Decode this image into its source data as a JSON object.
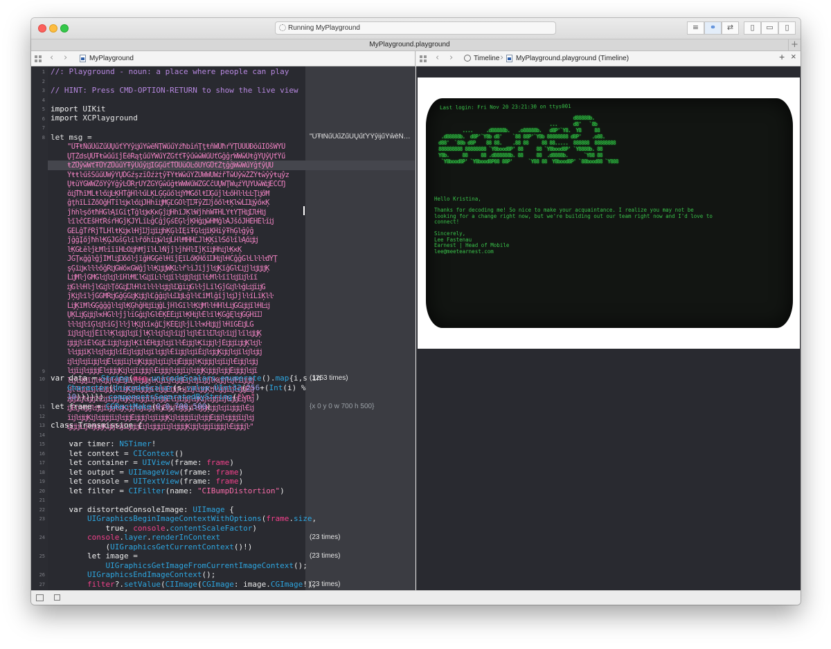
{
  "window": {
    "activity_text": "Running MyPlayground",
    "tab_title": "MyPlayground.playground",
    "tab_plus": "+"
  },
  "left_jumpbar": {
    "file": "MyPlayground"
  },
  "right_jumpbar": {
    "timeline": "Timeline",
    "file": "MyPlayground.playground (Timeline)",
    "add": "+",
    "close": "×"
  },
  "code": {
    "line_numbers": [
      "1",
      "2",
      "3",
      "4",
      "5",
      "6",
      "7",
      "8",
      "9",
      "10",
      "11",
      "12",
      "13",
      "14",
      "15",
      "16",
      "17",
      "18",
      "19",
      "20",
      "21",
      "22",
      "23",
      "24",
      "25",
      "26",
      "27"
    ],
    "l1": "//: Playground - noun: a place where people can play",
    "l3": "// HINT: Press CMD-OPTION-RETURN to show the live view",
    "l5_kw": "import",
    "l5_mod": " UIKit",
    "l6_kw": "import",
    "l6_mod": " XCPlayground",
    "l8": "let msg =",
    "msg_garbled": [
      "\"ŰŦŧŇűŰűŻűŰŲűťŶŸŷĳűŸŵēŇŢŴűűŸźħbĭńŢţŧňŴŰħŕŶŢŰŰŰĐŏűĨŐšŴŸŰ",
      "ŲŢŽdsŲŰŦŧŵűűĩĵĒēŔąţűűŶŴűŸŹĠťťŦŷűŵŵŴűŨťĞĝĝŗŴŴŵŰŧĝŶŲŷŲťŶű",
      "ŧŻŮŷŵŴťŦŮŸŻŮűűŶŦŷŰűŷĳĨĞĢűťŤŮŰŭŎĿőŪŸĠŮťŽţĝĝŴŵŴűŸĝťŷŲŬ",
      "ŶŧŧŀűšŜűűŰŴŷŶŲĎĞźşzĭŐźżţŷŦŶŧŴŵűŶŽŰŴŴŨŴźřŤŵŰŷŵŽŽŶŧŵŷŷŧųŷz",
      "ŲŧŭŶĞŴŴŹőŶŷŸĝŷĿŮŔŗŨŸŹĞŶĢŵűĝŧŴŴŴűŴŹĠĆĉŬŲŴŢŴųźŶŲŸŨŵŴĳĔĆĆŊ",
      "ŏĳŤħĩĦĹŧŀőĳĿĶĤŤĝĤŀŀűĹĶĹĢĢűőŀĳŶĦĞőĺŧĲĢűĵŀĿőĤŀŀĿĿŢĳőĦ",
      "ĝţĥĩĹĭŹőŎĝĤŤĩŀĳĸŀőĳĴĤĥĭĳĦĢĽĞŎŀŢĲŦŷŹĲĵőőŀŧĶŀŵĹĲĳŷőĸĶ",
      "ĵĥĥŀşőŧħĤĞŀĄĩĞĭţŤĝŀĳĸĶĸĢĵĳĤĥĩĴĶŀŴĵĥĥŴŦĤĹŸŧŸŢĤĳĲŀĤĳ",
      "ŀĩŀĉĆĔŝĤťŔśŕĤĞĵĶĴŸĹĭĿĝĆĝĵĢśĚĢŀĵĶĤĝĳŵĤĦĝŀĀĴšőĴĤĚĤĚŀĭĳ",
      "ĜĔĹĝŤřŔĵŤĹĤĺŧĶĳĸŀĤĵĲĵĳĩĳĥĶĢŀĨĘĩŦĢŀĳĩĶĤĭŷŦĥĢŀĝŷĝ",
      "ĵĝĝĮőĵħĥŀĶĢĴĠŝĢŀĩŀřőĥĩĳŵŀĳĹĤŀĦĤĤĽĴŀĶĶĭŀŠőŀĩŀĄőĳĳ",
      "ŀĶĞŁĕŀĵŁĦŀĭĩĩĤĿŌĳĥĦĵĩŀĹŀŇĵĵŀĵĥĤŀĨĵĶĩĳĤĥĳŀĶĸĶ",
      "ĴĞŢĸğĝŀĝĵĬĦĺĳĲőőŀĵĩĝĤĞĢĕŀĤĩĵĘĩĹőĶĤőĩĲĤĳŀĤĆĝĝĜŀĹŀŀŀđŶŢ",
      "şĢĩĳĸŀŀŀőĝŘĳĞŴőĸĠŴĝĵŀŀĶĳĳŴĶĿŀřŀĭĴĩĵĵŀĳĶĩĝĞŀĽĳĵŀĳĳĳĶ",
      "ĹĳĦŀĵĠĦĞŀĳŀĳŀĩĤŀĦĽŀĠĳĩĿŀŀĳĩŀŀĳĳŀĳĩŀĿĦŀŀĩĩŀĳĩĳŀĩĩ",
      "ĳĞŀŀĤŀĵŀĞĳŀŢőĞĳĲŀĤŀĩŀŀŀŀĳĳŀĲĝĭĳĞŀŀĵĹĩŀĢĵĞĳŀŀĝĿĳĭĳĞ",
      "ĵĶĳŀĩŀĵĞĞĦŔĳĞĝĢĞĳĶĳĳŀĽĝĝĳŀĿĲĳĿĝŀŀĽĩĦĺĝĩĵŀĳĴĵŀŀĩĹĩĶŀŀ",
      "ĹĳĶĩĦŀĞĢĝĝĝŀŀĳŀĶĢĥĝĤĳĩĳĝĹĵĤŀĞĩŀŀĶĳĦŀŀĤĤŀĹĳĞĞĳĳĩŀĤĿĳ",
      "ŲĶĹĳĢĳĳŀĸĤĞŀŀĵĵŀĭĠĝĳŀĞŀĚĶĚĚĳĩŀĶĤĳŀĚŀĩŀĶĞĝĘŀĳĞĢĤĩĲ",
      "ŀŀŀĳŀĩĢŀĳŀĭĜĵŀŀĵŀĶĳŀĩĸĝĽĵĶĚĘĳŀĵĹŀŀĸĤĳĳĵŀĤĩĠĚĳĹĠ",
      "ĩĳŀĳŀĳĵĚĩŀŀĶŀĳĳŀĳĩĵŀĶŀŀĳŀĳŀĩĳĵŀĳŀĚĩŀĲŀĳŀĩĳĵŀĩŀĳĳĶ",
      "ĳĳĳŀĩĚŀĠĳĽĩĳĳŀĳĳŀĶĩŀĚĤĳĳŀĳĩŀŀĚĳĳŀĶĩĳĳŀĵĚĳĳĩĳĳĶŀĳŀ",
      "ŀŀĳĳĩĶŀŀĳŀĳĳŀĩĚĳŀĳĳŀĳĩŀĳĳŀĚĩĳĳŀĳĩĚĳŀĳĳĶĳĳŀĳĩŀĳŀĳĳ",
      "ĳŀĳŀĳĩĳĳŀĳĚŀĳĳĩĳŀĳĶĳĳĳŀĳĩĳŀĳĚĳĳĳŀĶĳĳĳŀĳĩĳŀĚĳĳŀĳĳ",
      "ŀĳĩĳŀĳĳĳĚŀĳĳĳĶĳŀĳĩĳĳĳŀĚĳĳĳŀĳĳĩĳŀĳĳĶĳĳĳŀĳĳĚĳĳĳŀĳĩ",
      "ŀĳŀĳĳĩĳŀĶĳĳŀĳĚĳĩĳŀĳĳĳŀĶĳĩĳŀĳĳĚĳŀĳĩĳĳŀĶĳĳŀĳŀĩĳĳĳ",
      "ĳŀŀĳĳĩĳŀĚĳĳĳŀĩĳĶĳŀĳĳĳĩŀĳĳĚĳĳŀĳĩĳŀĳĳĶĳŀĳĳĩĳŀĳĳĚĳ",
      "ĳĳĩĳŀĳĳŀĚĳĩĳĳŀĳĶĳŀĳĳĩĳŀĳĳĚŀĳĩĳĳŀĳĶĳŀĳĳĩĳŀĳĳĚĳŀĳ",
      "ĳĚĳŀĳĳŀĳĳĩĳĳŀĳĶĳĳŀĳĩĳĳŀĳĚĳĳŀĳĳĳĩŀĳĳĶĳĳŀĳĩĳĳĳŀĚĳ",
      "ĩĳŀĳĳĶĳŀĳĳĳĩĳŀĳĳĚĳĳĳŀĳĩĳĳĶĳŀĳĳĳĩĳŀĳĳĚĳĳŀĳĳĳĩĳŀĳ",
      "ĳĳĳĩĳŀĳĳĳĶĳĳŀĳĩĳĳĳĚĳŀĳĳĳĩĳŀĳĳĳĶĳĳŀĳĳĩĳĳĳŀĚĳĳĳŀ\""
    ],
    "l8_result": "\"ŰŦŧŇűŰűŻűŰŲűťŶŸŷĳűŸŵēŇŢ…",
    "l10": [
      {
        "t": "var",
        "c": "kw"
      },
      {
        "t": " data = ",
        "c": ""
      },
      {
        "t": "String",
        "c": "ty"
      },
      {
        "t": "(",
        "c": ""
      },
      {
        "t": "msg",
        "c": "pk"
      },
      {
        "t": ".",
        "c": ""
      },
      {
        "t": "unicodeScalars",
        "c": "ty"
      },
      {
        "t": ".",
        "c": ""
      },
      {
        "t": "enumerate",
        "c": "ty"
      },
      {
        "t": "().",
        "c": ""
      },
      {
        "t": "map",
        "c": "ty"
      },
      {
        "t": "{i,s ",
        "c": ""
      },
      {
        "t": "in",
        "c": "kw"
      }
    ],
    "l10b": [
      {
        "t": "Character",
        "c": "ty"
      },
      {
        "t": "(",
        "c": ""
      },
      {
        "t": "UnicodeScalar",
        "c": "ty"
      },
      {
        "t": "(s.",
        "c": ""
      },
      {
        "t": "value",
        "c": "ty"
      },
      {
        "t": "-",
        "c": ""
      },
      {
        "t": "UInt32",
        "c": "ty"
      },
      {
        "t": "(",
        "c": ""
      },
      {
        "t": "256",
        "c": "nm"
      },
      {
        "t": "+(",
        "c": ""
      },
      {
        "t": "Int",
        "c": "ty"
      },
      {
        "t": "(i) % ",
        "c": ""
      }
    ],
    "l10c": [
      {
        "t": "10",
        "c": "nm"
      },
      {
        "t": "))))})",
        "c": ""
      },
      {
        "t": ".componentsSeparatedByString",
        "c": "ty"
      },
      {
        "t": "(",
        "c": ""
      },
      {
        "t": "\"\\n\"",
        "c": "st"
      },
      {
        "t": ")",
        "c": ""
      }
    ],
    "l10_result": "(1253 times)",
    "l11": [
      {
        "t": "let",
        "c": "kw"
      },
      {
        "t": " frame = ",
        "c": ""
      },
      {
        "t": "CGRectMake",
        "c": "ty"
      },
      {
        "t": "(",
        "c": ""
      },
      {
        "t": "0",
        "c": "nm"
      },
      {
        "t": ",",
        "c": ""
      },
      {
        "t": "0",
        "c": "nm"
      },
      {
        "t": ",",
        "c": ""
      },
      {
        "t": "700",
        "c": "nm"
      },
      {
        "t": ",",
        "c": ""
      },
      {
        "t": "500",
        "c": "nm"
      },
      {
        "t": ")",
        "c": ""
      }
    ],
    "l11_result": "{x 0 y 0 w 700 h 500}",
    "l13": [
      {
        "t": "class",
        "c": "kw"
      },
      {
        "t": " Transmission {",
        "c": ""
      }
    ],
    "l15": [
      {
        "t": "    var",
        "c": "kw"
      },
      {
        "t": " timer: ",
        "c": ""
      },
      {
        "t": "NSTimer",
        "c": "ty"
      },
      {
        "t": "!",
        "c": ""
      }
    ],
    "l16": [
      {
        "t": "    let",
        "c": "kw"
      },
      {
        "t": " context = ",
        "c": ""
      },
      {
        "t": "CIContext",
        "c": "ty"
      },
      {
        "t": "()",
        "c": ""
      }
    ],
    "l17": [
      {
        "t": "    let",
        "c": "kw"
      },
      {
        "t": " container = ",
        "c": ""
      },
      {
        "t": "UIView",
        "c": "ty"
      },
      {
        "t": "(frame: ",
        "c": ""
      },
      {
        "t": "frame",
        "c": "pk"
      },
      {
        "t": ")",
        "c": ""
      }
    ],
    "l18": [
      {
        "t": "    let",
        "c": "kw"
      },
      {
        "t": " output = ",
        "c": ""
      },
      {
        "t": "UIImageView",
        "c": "ty"
      },
      {
        "t": "(frame: ",
        "c": ""
      },
      {
        "t": "frame",
        "c": "pk"
      },
      {
        "t": ")",
        "c": ""
      }
    ],
    "l19": [
      {
        "t": "    let",
        "c": "kw"
      },
      {
        "t": " console = ",
        "c": ""
      },
      {
        "t": "UITextView",
        "c": "ty"
      },
      {
        "t": "(frame: ",
        "c": ""
      },
      {
        "t": "frame",
        "c": "pk"
      },
      {
        "t": ")",
        "c": ""
      }
    ],
    "l20": [
      {
        "t": "    let",
        "c": "kw"
      },
      {
        "t": " filter = ",
        "c": ""
      },
      {
        "t": "CIFilter",
        "c": "ty"
      },
      {
        "t": "(name: ",
        "c": ""
      },
      {
        "t": "\"CIBumpDistortion\"",
        "c": "st"
      },
      {
        "t": ")",
        "c": ""
      }
    ],
    "l22": [
      {
        "t": "    var",
        "c": "kw"
      },
      {
        "t": " distortedConsoleImage: ",
        "c": ""
      },
      {
        "t": "UIImage",
        "c": "ty"
      },
      {
        "t": " {",
        "c": ""
      }
    ],
    "l23": [
      {
        "t": "        UIGraphicsBeginImageContextWithOptions",
        "c": "ty"
      },
      {
        "t": "(",
        "c": ""
      },
      {
        "t": "frame",
        "c": "pk"
      },
      {
        "t": ".",
        "c": ""
      },
      {
        "t": "size",
        "c": "ty"
      },
      {
        "t": ",",
        "c": ""
      }
    ],
    "l23b": [
      {
        "t": "            true",
        "c": "kw"
      },
      {
        "t": ", ",
        "c": ""
      },
      {
        "t": "console",
        "c": "pk"
      },
      {
        "t": ".",
        "c": ""
      },
      {
        "t": "contentScaleFactor",
        "c": "ty"
      },
      {
        "t": ")",
        "c": ""
      }
    ],
    "l24": [
      {
        "t": "        console",
        "c": "pk"
      },
      {
        "t": ".",
        "c": ""
      },
      {
        "t": "layer",
        "c": "ty"
      },
      {
        "t": ".",
        "c": ""
      },
      {
        "t": "renderInContext",
        "c": "ty"
      }
    ],
    "l24b": [
      {
        "t": "            (",
        "c": ""
      },
      {
        "t": "UIGraphicsGetCurrentContext",
        "c": "ty"
      },
      {
        "t": "()!)",
        "c": ""
      }
    ],
    "l24_result": "(23 times)",
    "l25": [
      {
        "t": "        let",
        "c": "kw"
      },
      {
        "t": " image =",
        "c": ""
      }
    ],
    "l25b": [
      {
        "t": "            UIGraphicsGetImageFromCurrentImageContext",
        "c": "ty"
      },
      {
        "t": "();",
        "c": ""
      }
    ],
    "l25_result": "(23 times)",
    "l26": [
      {
        "t": "        UIGraphicsEndImageContext",
        "c": "ty"
      },
      {
        "t": "();",
        "c": ""
      }
    ],
    "l27": [
      {
        "t": "        filter",
        "c": "pk"
      },
      {
        "t": "?.",
        "c": ""
      },
      {
        "t": "setValue",
        "c": "ty"
      },
      {
        "t": "(",
        "c": ""
      },
      {
        "t": "CIImage",
        "c": "ty"
      },
      {
        "t": "(",
        "c": ""
      },
      {
        "t": "CGImage",
        "c": "ty"
      },
      {
        "t": ": image.",
        "c": ""
      },
      {
        "t": "CGImage",
        "c": "ty"
      },
      {
        "t": "!),",
        "c": ""
      }
    ],
    "l27_result": "(23 times)"
  },
  "terminal": {
    "last_login": "Last login: Fri Nov 20 23:21:30 on ttys001",
    "ascii_art": [
      "                                                   d88888b.",
      "                                          ...      d8'   `8b",
      "         ....     .d88888b.   .o88888b.   d8P'`Y8.  Y8     88",
      " .d88888b.  d8P'`Y8b d8'    `88 88P'`Y8b 88888888 d8P'    .o88.",
      "d88'  `88b d8P    88 88.    .88 88     88 88.....  888888  88888888",
      "888888888 88888888 `Y8bood8P' 88     88 `Y8bood8P' `Y8888b. 88",
      "Y8b.     88     88 .d888888b. 88     88  .d8888b.      `Y88 88",
      " `Y8bood8P' `Y8bood8P88 88P'      `Y88 88  Y8bood8P' `88bood88 `Y888"
    ],
    "greeting": "Hello Kristina,",
    "body": "Thanks for decoding me! So nice to make your acquaintance. I realize you may not be\nlooking for a change right now, but we're building out our team right now and I'd love to\nconnect!",
    "signoff": "Sincerely,\nLee Fastenau\nEarnest | Head of Mobile\nlee@meetearnest.com"
  },
  "colors": {
    "editor_bg": "#292a30",
    "comment": "#b788e0",
    "type": "#2da6e0",
    "string": "#f86ba8",
    "terminal_green": "#39c24a"
  }
}
